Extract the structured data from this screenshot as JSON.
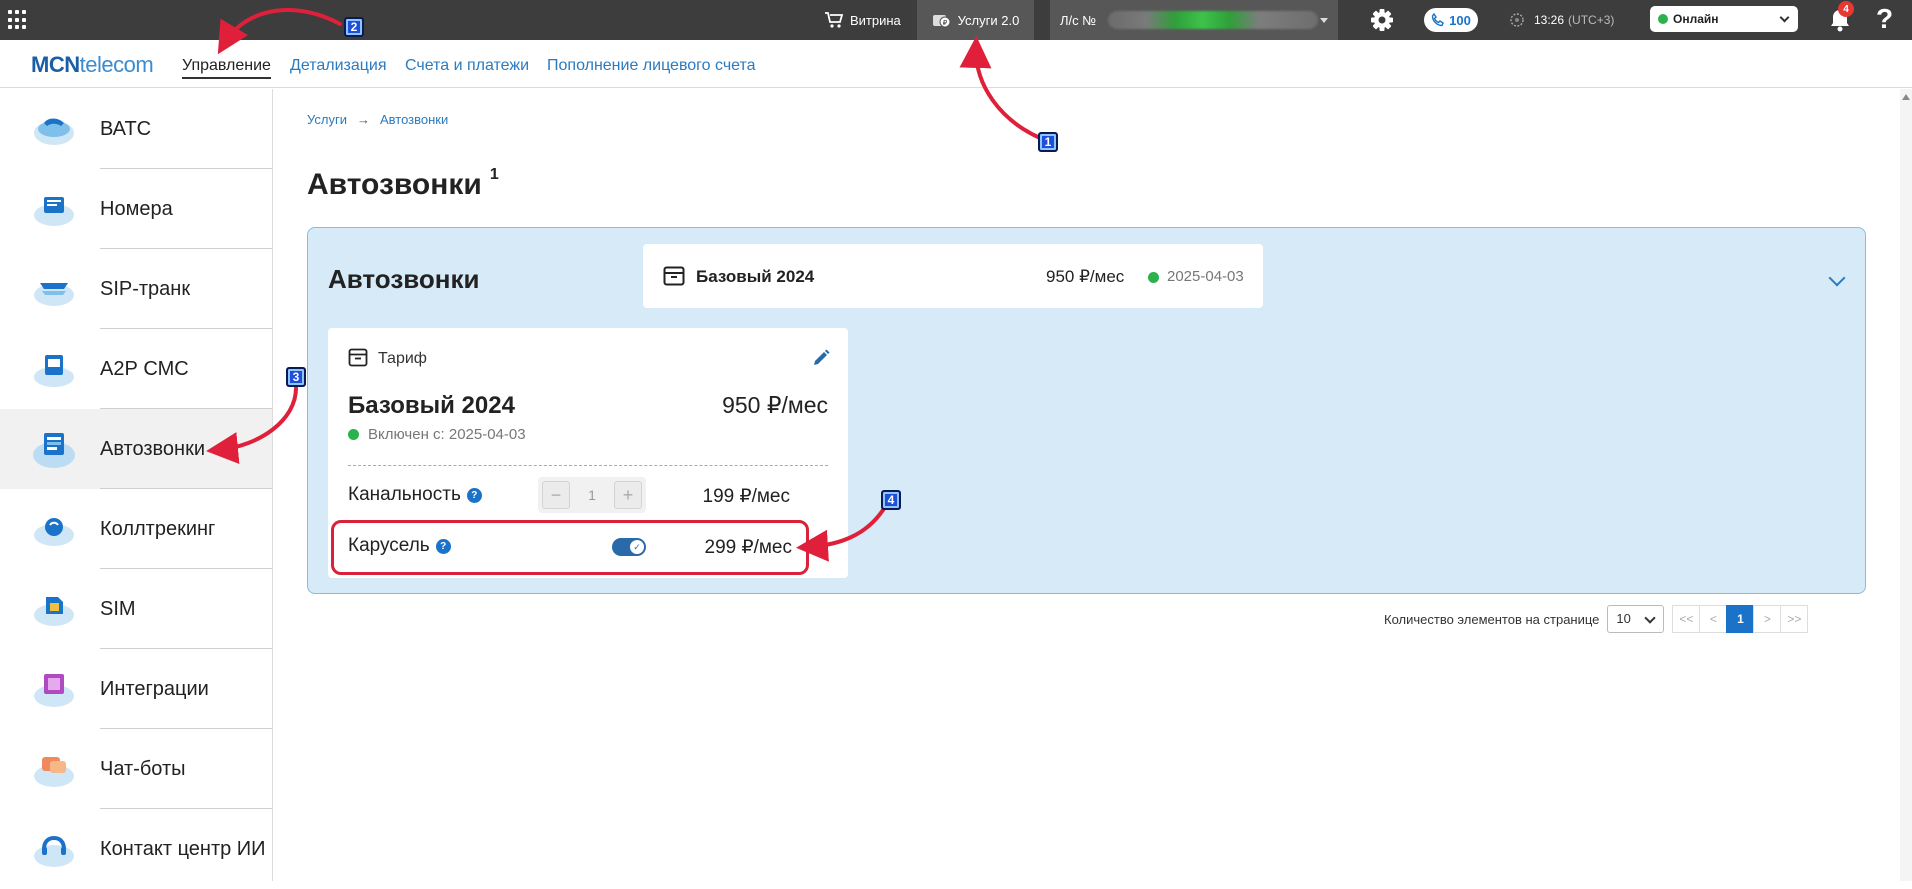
{
  "topbar": {
    "vitrina": "Витрина",
    "uslugi": "Услуги 2.0",
    "account_prefix": "Л/с №",
    "calls_count": "100",
    "time": "13:26",
    "utc": "(UTC+3)",
    "status": "Онлайн",
    "notifications": "4",
    "help": "?"
  },
  "subnav": {
    "logo_bold": "MCN",
    "logo_rest": "telecom",
    "links": [
      "Управление",
      "Детализация",
      "Счета и платежи",
      "Пополнение лицевого счета"
    ]
  },
  "sidebar": {
    "items": [
      "ВАТС",
      "Номера",
      "SIP-транк",
      "А2Р СМС",
      "Автозвонки",
      "Коллтрекинг",
      "SIM",
      "Интеграции",
      "Чат-боты",
      "Контакт центр ИИ"
    ],
    "active_index": 4
  },
  "breadcrumb": [
    "Услуги",
    "Автозвонки"
  ],
  "page_title": "Автозвонки",
  "page_count": "1",
  "service": {
    "title": "Автозвонки",
    "summary": {
      "tariff_name": "Базовый 2024",
      "price": "950 ₽/мес",
      "date": "2025-04-03"
    },
    "tariff_card": {
      "label": "Тариф",
      "name": "Базовый 2024",
      "price": "950 ₽/мес",
      "since": "Включен с: 2025-04-03",
      "options": [
        {
          "label": "Канальность",
          "value": "1",
          "price": "199 ₽/мес"
        },
        {
          "label": "Карусель",
          "enabled": true,
          "price": "299 ₽/мес"
        }
      ]
    }
  },
  "pagination": {
    "label": "Количество элементов на странице",
    "per_page": "10",
    "first": "<<",
    "prev": "<",
    "current": "1",
    "next": ">",
    "last": ">>"
  },
  "markers": [
    "1",
    "2",
    "3",
    "4"
  ],
  "colors": {
    "topbar": "#3d3d3d",
    "accent": "#1a73c9",
    "panel": "#d6ebf7",
    "online": "#2bb24c",
    "annotation": "#d9213a"
  }
}
